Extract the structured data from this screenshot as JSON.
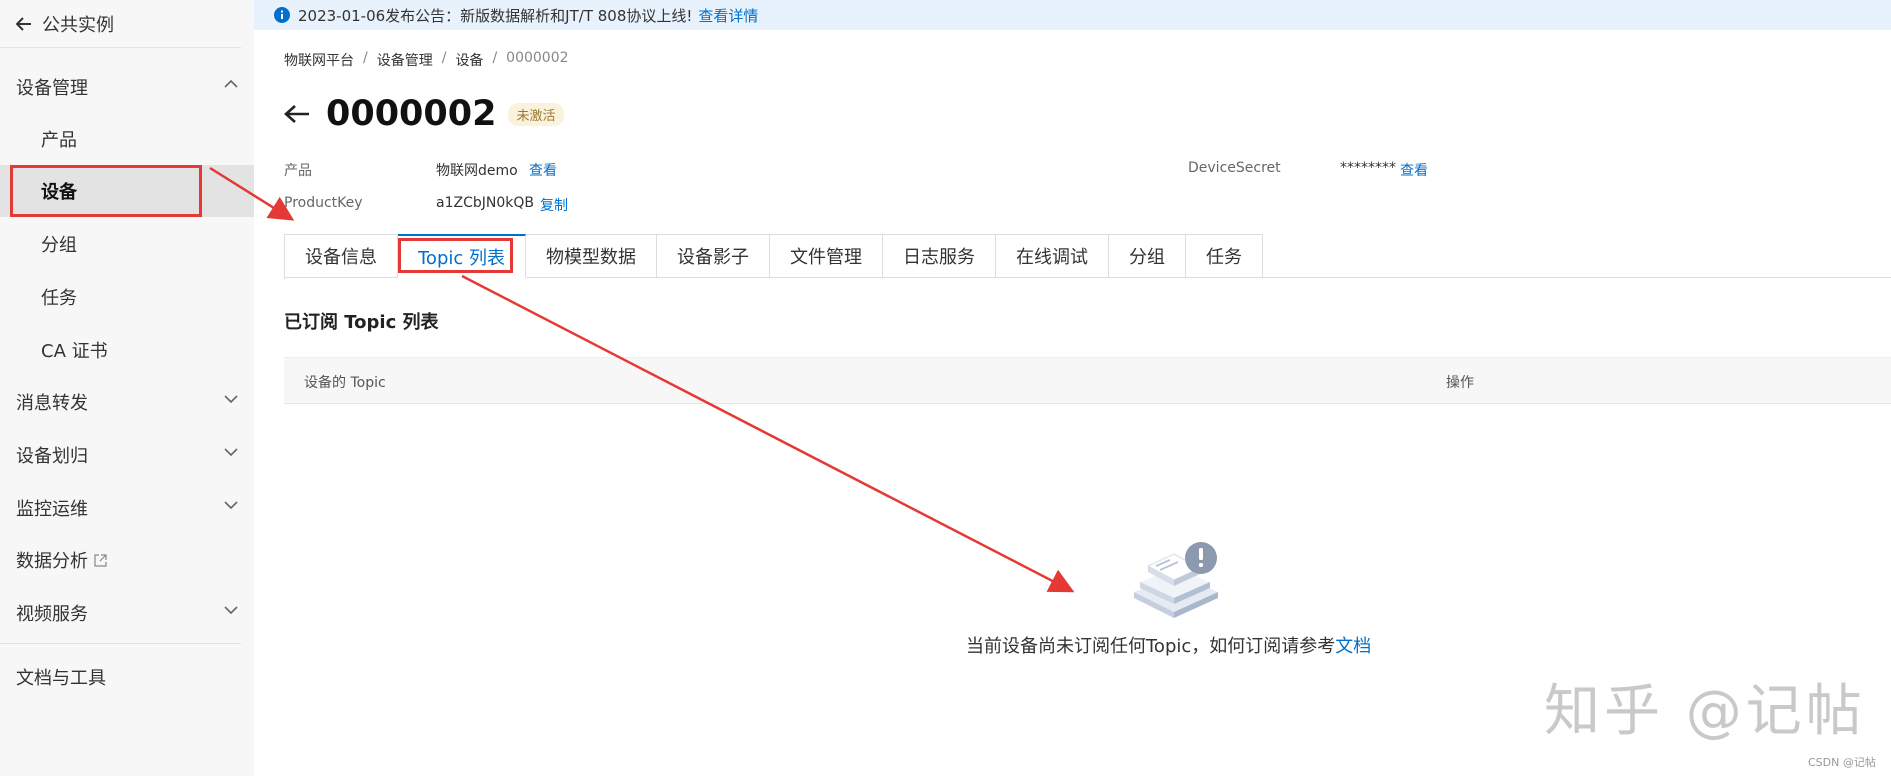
{
  "sidebar": {
    "back_label": "公共实例",
    "groups": [
      {
        "label": "设备管理"
      },
      {
        "label": "消息转发"
      },
      {
        "label": "设备划归"
      },
      {
        "label": "监控运维"
      },
      {
        "label": "数据分析"
      },
      {
        "label": "视频服务"
      },
      {
        "label": "文档与工具"
      }
    ],
    "items": [
      {
        "label": "产品"
      },
      {
        "label": "设备"
      },
      {
        "label": "分组"
      },
      {
        "label": "任务"
      },
      {
        "label": "CA 证书"
      }
    ]
  },
  "notice": {
    "text": "2023-01-06发布公告：新版数据解析和JT/T 808协议上线!",
    "link": "查看详情"
  },
  "breadcrumb": {
    "items": [
      "物联网平台",
      "设备管理",
      "设备",
      "0000002"
    ],
    "separator": "/"
  },
  "device": {
    "name": "0000002",
    "status": "未激活",
    "product_label": "产品",
    "product_value": "物联网demo",
    "product_link": "查看",
    "productkey_label": "ProductKey",
    "productkey_value": "a1ZCbJN0kQB",
    "productkey_link": "复制",
    "secret_label": "DeviceSecret",
    "secret_value": "********",
    "secret_link": "查看"
  },
  "tabs": [
    "设备信息",
    "Topic 列表",
    "物模型数据",
    "设备影子",
    "文件管理",
    "日志服务",
    "在线调试",
    "分组",
    "任务"
  ],
  "section": {
    "title": "已订阅 Topic 列表",
    "columns": [
      "设备的 Topic",
      "操作"
    ]
  },
  "empty": {
    "text": "当前设备尚未订阅任何Topic，如何订阅请参考",
    "link": "文档"
  },
  "watermark": "知乎 @记帖",
  "credit": "CSDN @记帖",
  "colors": {
    "accent": "#0070cc",
    "annotation_red": "#e53935",
    "badge_bg": "#fbf2dd",
    "sidebar_bg": "#f7f7f7"
  }
}
